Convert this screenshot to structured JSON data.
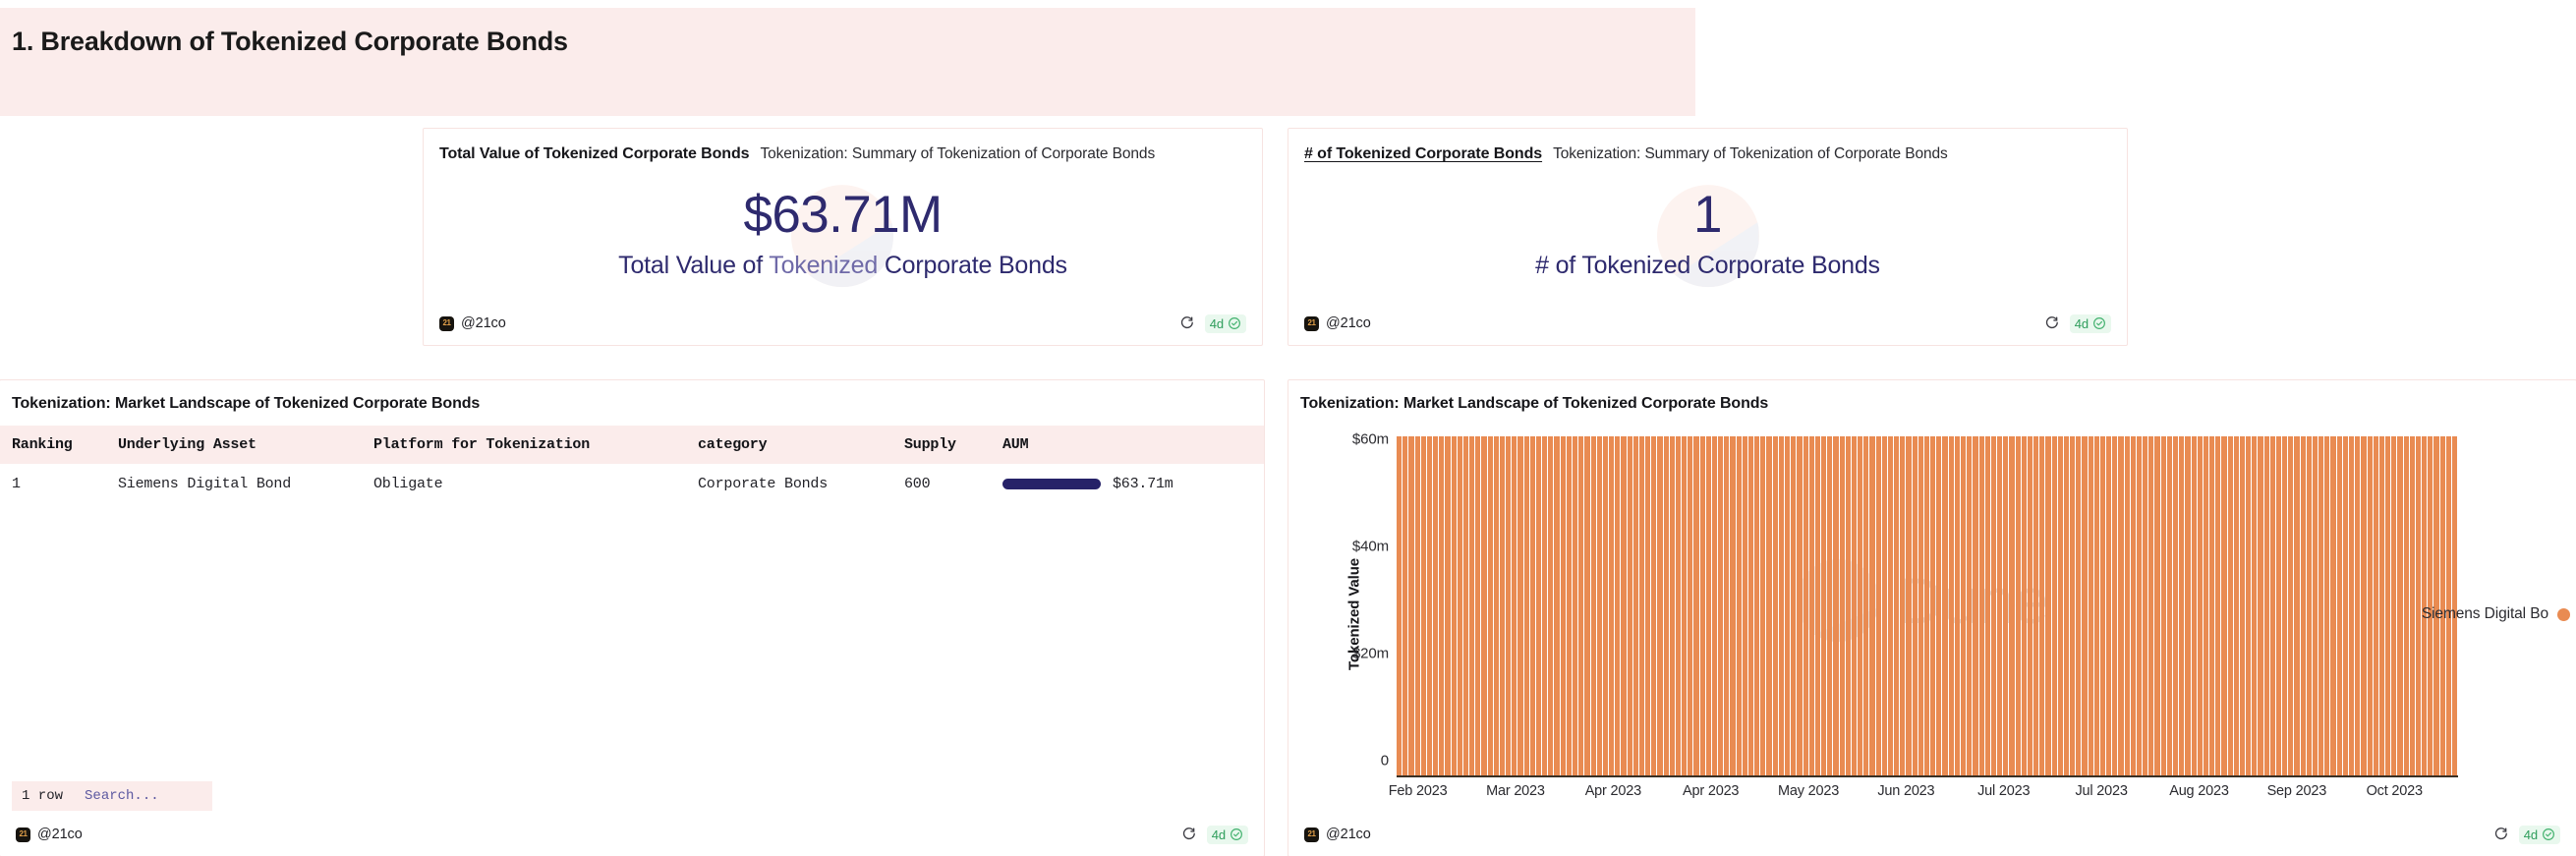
{
  "header": {
    "title": "1. Breakdown of Tokenized Corporate Bonds",
    "banner_color": "#fbeceb"
  },
  "theme": {
    "accent_orange": "#e98b52",
    "navy": "#2e2a6e",
    "bar_navy": "#262268",
    "pink_bg": "#fbeceb",
    "green": "#2f9e5c",
    "card_border": "#f7e3e1"
  },
  "counter_cards": [
    {
      "title": "Total Value of Tokenized Corporate Bonds",
      "subtitle": "Tokenization: Summary of Tokenization of Corporate Bonds",
      "value": "$63.71M",
      "label_prefix": "Total Value of ",
      "label_highlight": "Tokenized",
      "label_suffix": " Corporate Bonds",
      "title_underlined": false,
      "footer": {
        "avatar_text": "21",
        "handle": "@21co",
        "refresh_icon": "refresh-icon",
        "freshness": "4d",
        "check_icon": "check-circle-icon"
      }
    },
    {
      "title": "# of Tokenized Corporate Bonds",
      "subtitle": "Tokenization: Summary of Tokenization of Corporate Bonds",
      "value": "1",
      "label_prefix": "",
      "label_highlight": "",
      "label_suffix": "# of Tokenized Corporate Bonds",
      "title_underlined": true,
      "footer": {
        "avatar_text": "21",
        "handle": "@21co",
        "refresh_icon": "refresh-icon",
        "freshness": "4d",
        "check_icon": "check-circle-icon"
      }
    }
  ],
  "table_panel": {
    "title": "Tokenization: Market Landscape of Tokenized Corporate Bonds",
    "columns": [
      "Ranking",
      "Underlying Asset",
      "Platform for Tokenization",
      "category",
      "Supply",
      "AUM"
    ],
    "rows": [
      {
        "Ranking": "1",
        "Underlying Asset": "Siemens Digital Bond",
        "Platform for Tokenization": "Obligate",
        "category": "Corporate Bonds",
        "Supply": "600",
        "AUM": "$63.71m",
        "aum_bar_pct": 100
      }
    ],
    "row_count_label": "1 row",
    "search_placeholder": "Search...",
    "search_value": "",
    "footer": {
      "avatar_text": "21",
      "handle": "@21co",
      "refresh_icon": "refresh-icon",
      "freshness": "4d",
      "check_icon": "check-circle-icon"
    }
  },
  "chart_panel": {
    "title": "Tokenization: Market Landscape of Tokenized Corporate Bonds",
    "watermark": "Dune",
    "footer": {
      "avatar_text": "21",
      "handle": "@21co",
      "refresh_icon": "refresh-icon",
      "freshness": "4d",
      "check_icon": "check-circle-icon"
    }
  },
  "chart_data": {
    "type": "bar",
    "title": "Tokenization: Market Landscape of Tokenized Corporate Bonds",
    "xlabel": "",
    "ylabel": "Tokenized Value",
    "ylim": [
      0,
      66
    ],
    "yticks": [
      0,
      20,
      40,
      60
    ],
    "ytick_labels": [
      "0",
      "$20m",
      "$40m",
      "$60m"
    ],
    "xtick_labels": [
      "Feb 2023",
      "Mar 2023",
      "Apr 2023",
      "Apr 2023",
      "May 2023",
      "Jun 2023",
      "Jul 2023",
      "Jul 2023",
      "Aug 2023",
      "Sep 2023",
      "Oct 2023"
    ],
    "grid": false,
    "legend_position": "right",
    "series": [
      {
        "name": "Siemens Digital Bo",
        "color": "#e98b52",
        "constant_value": 63.71,
        "n_bars": 175,
        "values": [
          63.71
        ]
      }
    ]
  }
}
